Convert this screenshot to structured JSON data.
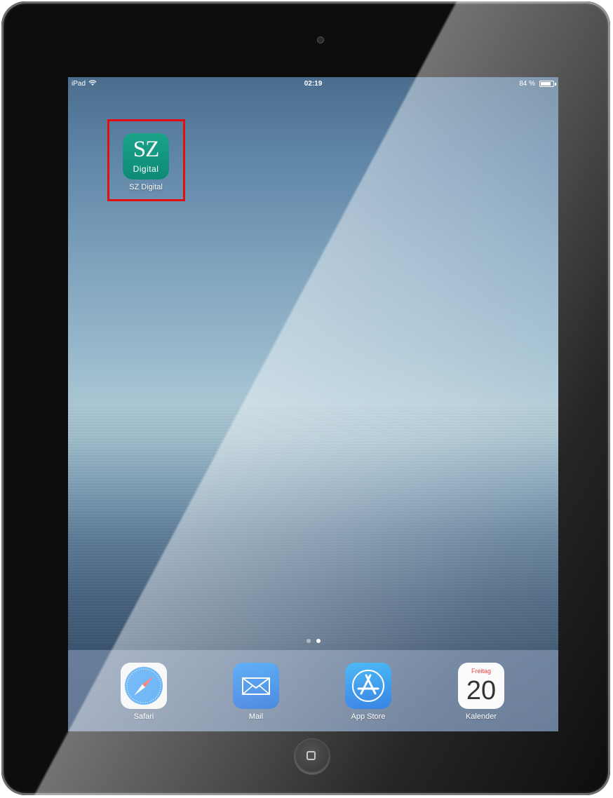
{
  "status_bar": {
    "carrier": "iPad",
    "time": "02:19",
    "battery_percent": "84 %",
    "battery_level": 0.84
  },
  "home_apps": [
    {
      "name": "SZ Digital",
      "icon_text_top": "SZ",
      "icon_text_bottom": "Digital",
      "icon": "sz-digital-icon",
      "color": "#12967f",
      "highlighted": true
    }
  ],
  "page_indicator": {
    "pages": 2,
    "current": 2
  },
  "dock": [
    {
      "name": "Safari",
      "icon": "safari-icon"
    },
    {
      "name": "Mail",
      "icon": "mail-icon"
    },
    {
      "name": "App Store",
      "icon": "app-store-icon"
    },
    {
      "name": "Kalender",
      "icon": "calendar-icon",
      "day_name": "Freitag",
      "day_number": "20"
    }
  ],
  "colors": {
    "highlight": "#e01010",
    "sz_green": "#12967f",
    "calendar_red": "#e8302a"
  }
}
